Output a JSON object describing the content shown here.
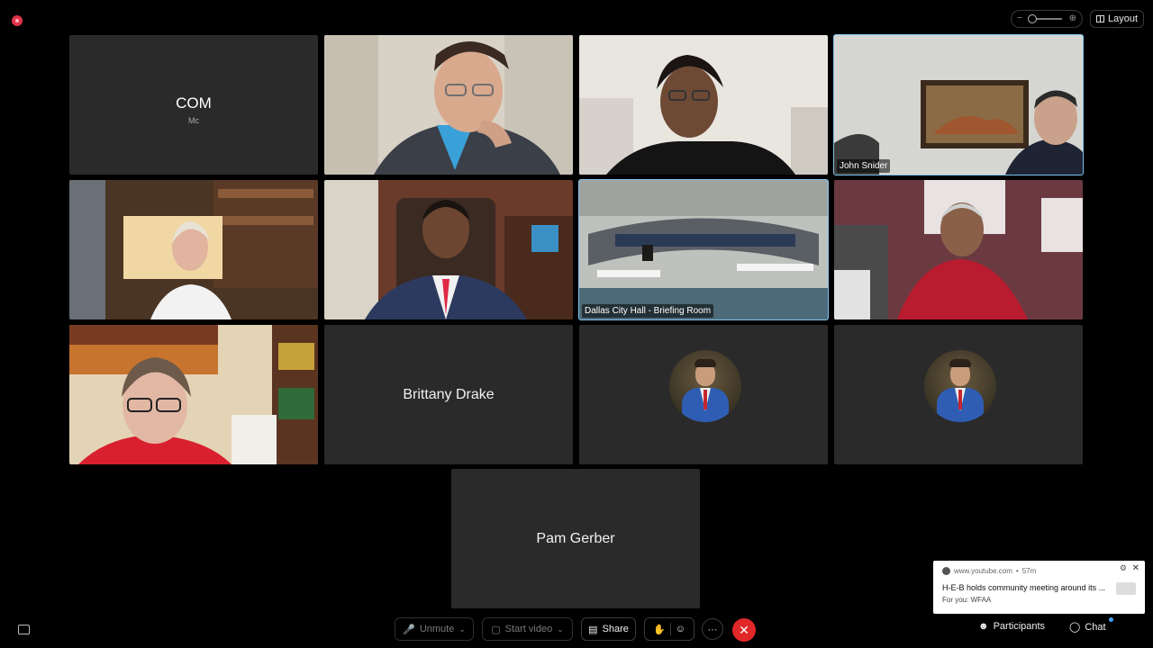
{
  "top_bar": {
    "layout_label": "Layout"
  },
  "tiles": {
    "com": {
      "title": "COM",
      "subtitle": "Mc"
    },
    "john": {
      "label": "John Snider"
    },
    "city_hall": {
      "label": "Dallas City Hall - Briefing Room"
    },
    "brittany": {
      "name": "Brittany Drake"
    },
    "pam": {
      "name": "Pam Gerber"
    }
  },
  "toolbar": {
    "unmute_label": "Unmute",
    "start_video_label": "Start video",
    "share_label": "Share",
    "participants_label": "Participants",
    "chat_label": "Chat"
  },
  "toast": {
    "source": "www.youtube.com",
    "age": "57m",
    "headline": "H-E-B holds community meeting around its ...",
    "for_you": "For you: WFAA"
  },
  "colors": {
    "active_border": "#7ec3ee",
    "leave_button": "#e02828",
    "tile_background": "#2a2a2a"
  }
}
